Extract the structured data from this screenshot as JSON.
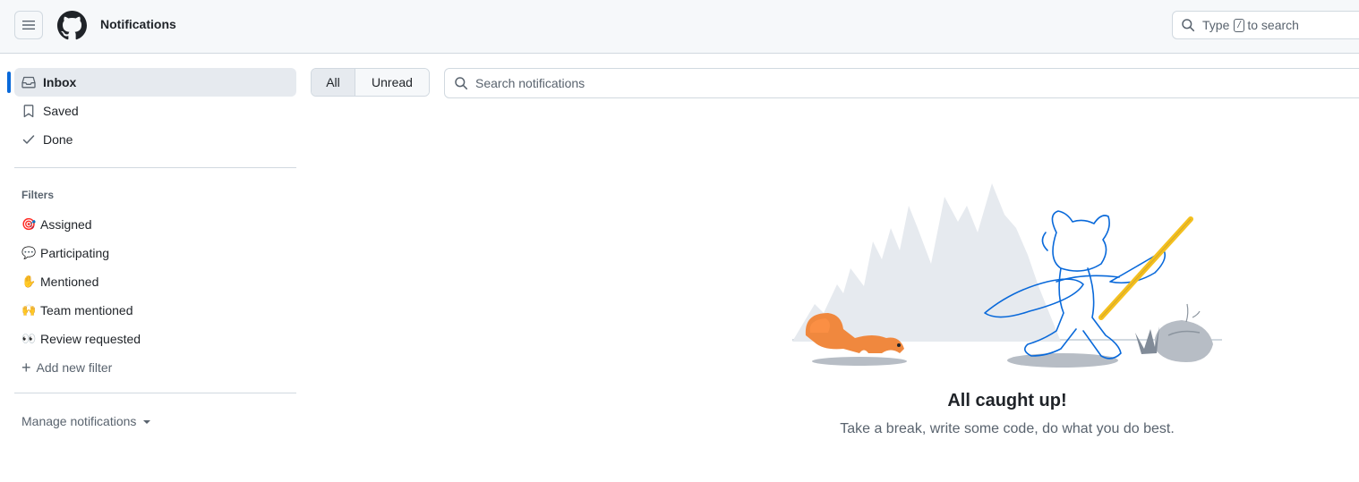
{
  "header": {
    "title": "Notifications",
    "menu_icon": "three-bars-icon",
    "logo_icon": "github-mark-icon",
    "search": {
      "prefix": "Type",
      "key": "/",
      "suffix": "to search"
    }
  },
  "sidebar": {
    "nav": [
      {
        "label": "Inbox",
        "icon": "inbox-icon",
        "active": true
      },
      {
        "label": "Saved",
        "icon": "bookmark-icon",
        "active": false
      },
      {
        "label": "Done",
        "icon": "check-icon",
        "active": false
      }
    ],
    "filters_heading": "Filters",
    "filters": [
      {
        "emoji": "🎯",
        "label": "Assigned"
      },
      {
        "emoji": "💬",
        "label": "Participating"
      },
      {
        "emoji": "✋",
        "label": "Mentioned"
      },
      {
        "emoji": "🙌",
        "label": "Team mentioned"
      },
      {
        "emoji": "👀",
        "label": "Review requested"
      }
    ],
    "add_filter": "Add new filter",
    "manage": "Manage notifications"
  },
  "main": {
    "segments": [
      {
        "label": "All",
        "selected": true
      },
      {
        "label": "Unread",
        "selected": false
      }
    ],
    "search_placeholder": "Search notifications",
    "empty_title": "All caught up!",
    "empty_subtitle": "Take a break, write some code, do what you do best."
  },
  "colors": {
    "accent": "#0969da",
    "text": "#1f2328",
    "muted": "#59636e",
    "border": "#d1d9e0"
  }
}
